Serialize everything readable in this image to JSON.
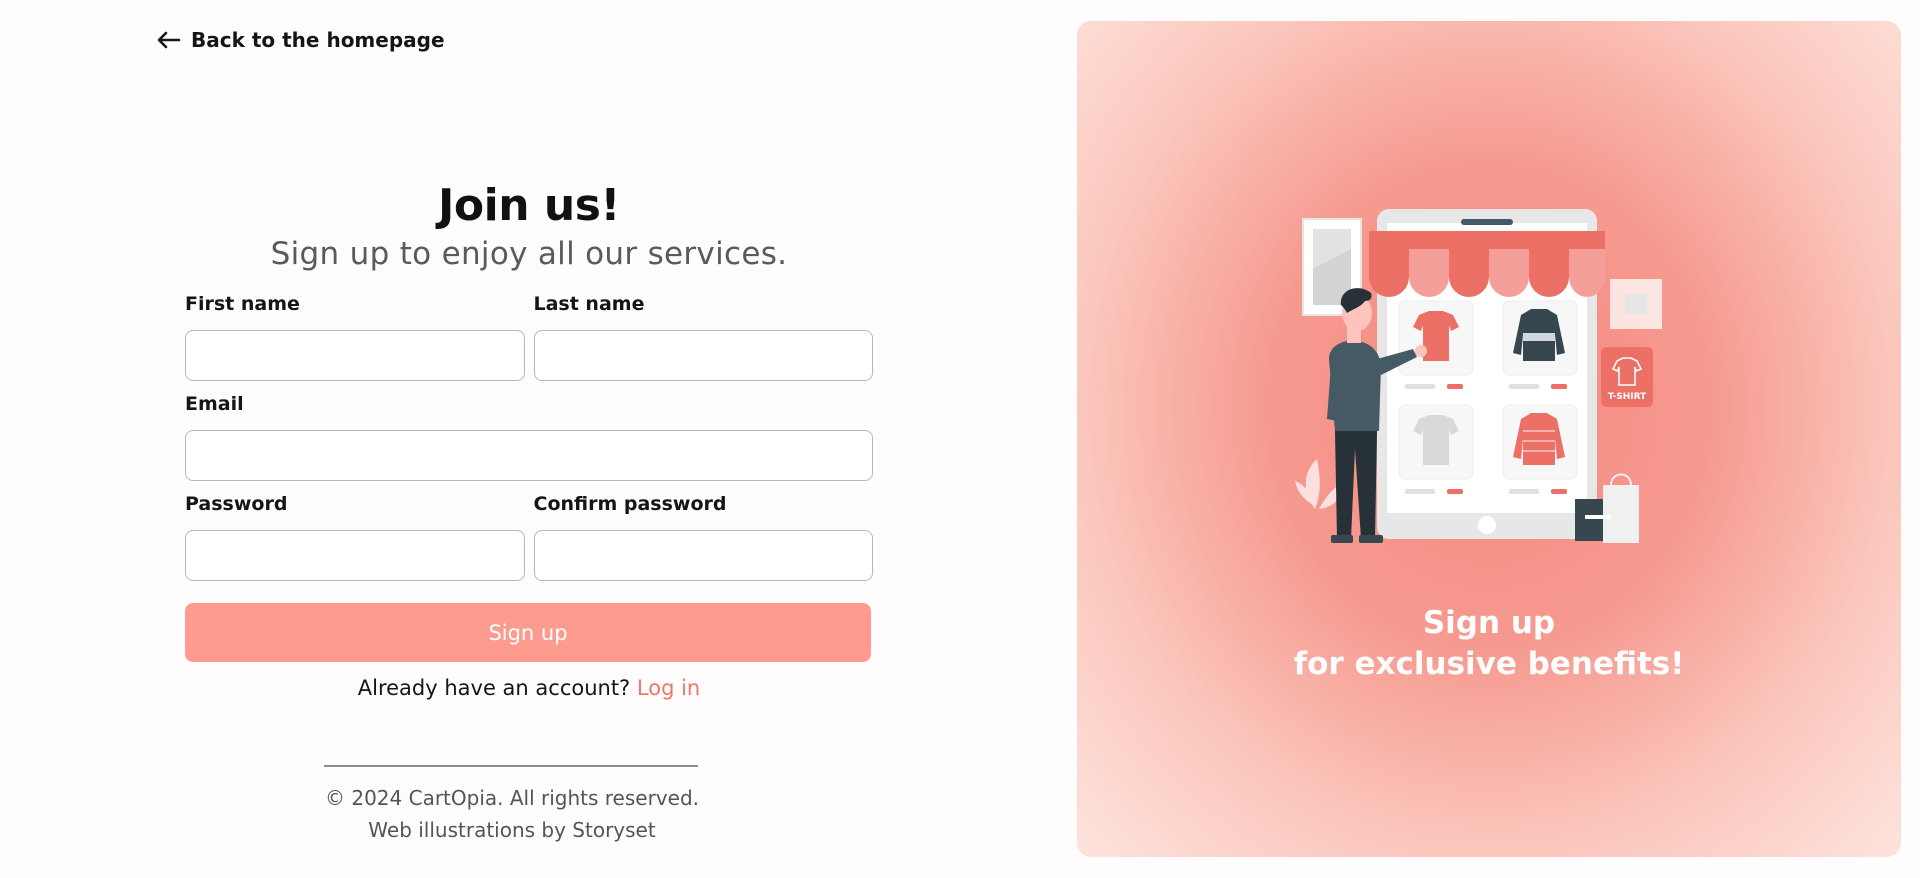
{
  "nav": {
    "back_label": "Back to the homepage"
  },
  "form": {
    "title": "Join us!",
    "subtitle": "Sign up to enjoy all our services.",
    "first_name_label": "First name",
    "last_name_label": "Last name",
    "email_label": "Email",
    "password_label": "Password",
    "confirm_password_label": "Confirm password",
    "first_name_value": "",
    "last_name_value": "",
    "email_value": "",
    "password_value": "",
    "confirm_password_value": "",
    "submit_label": "Sign up",
    "login_prompt": "Already have an account?",
    "login_link": "Log in"
  },
  "footer": {
    "copyright": "© 2024 CartOpia. All rights reserved.",
    "credit": "Web illustrations by Storyset"
  },
  "promo": {
    "line1": "Sign up",
    "line2": "for exclusive benefits!",
    "badge_text": "T-SHIRT"
  },
  "colors": {
    "accent": "#fe9b8f",
    "link": "#f0786b",
    "promo_center": "#f4877d",
    "promo_edge": "#fde4dd"
  }
}
